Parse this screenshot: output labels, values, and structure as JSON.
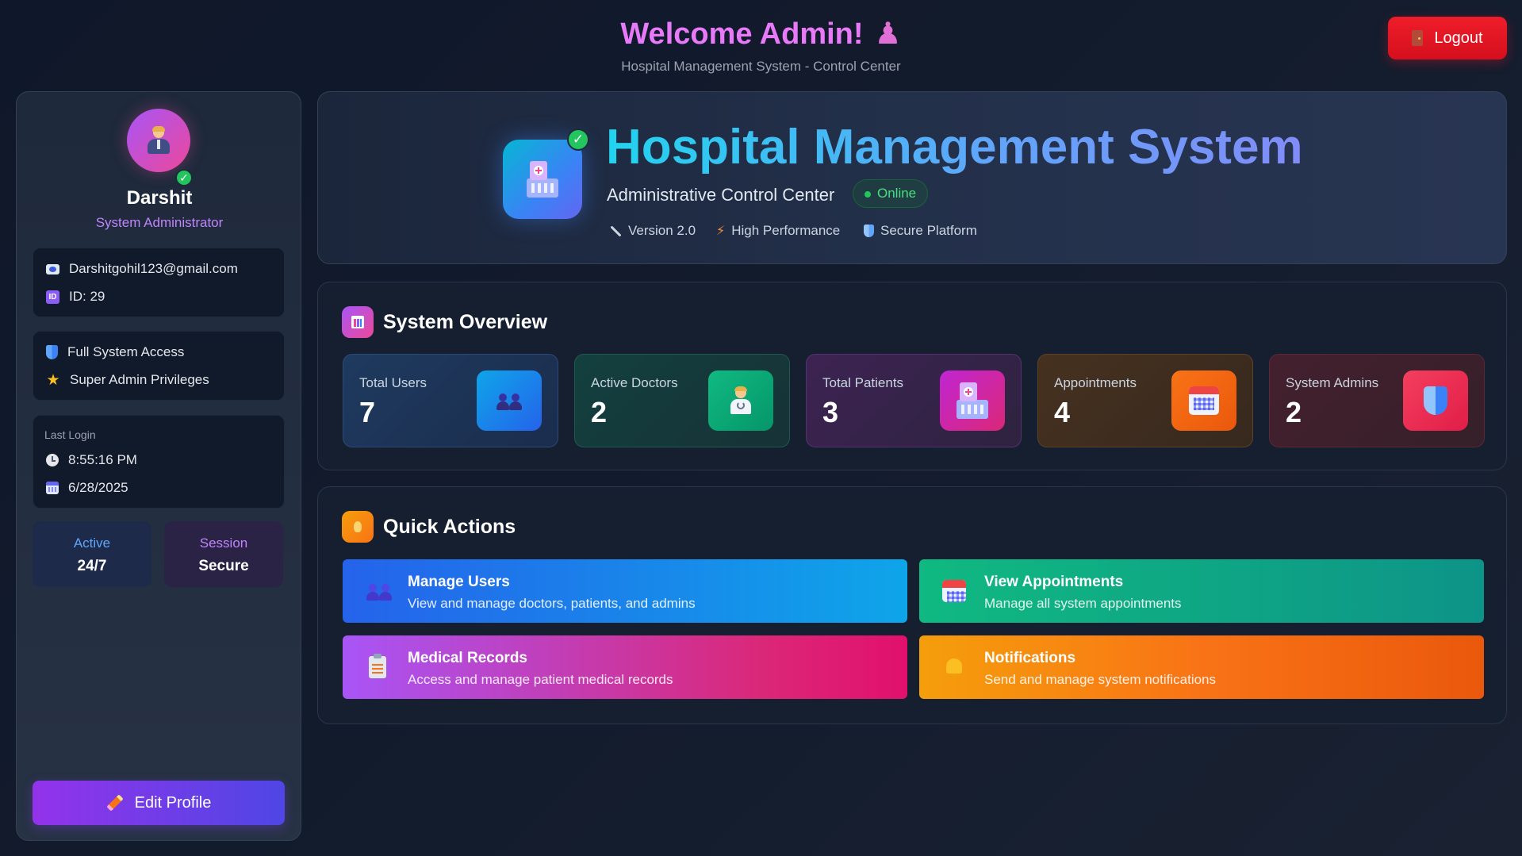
{
  "header": {
    "welcome": "Welcome Admin!",
    "subtitle": "Hospital Management System - Control Center",
    "logout_label": "Logout"
  },
  "profile": {
    "name": "Darshit",
    "role": "System Administrator",
    "email": "Darshitgohil123@gmail.com",
    "id": "ID: 29",
    "permissions": [
      "Full System Access",
      "Super Admin Privileges"
    ],
    "last_login_label": "Last Login",
    "last_login_time": "8:55:16 PM",
    "last_login_date": "6/28/2025",
    "status": {
      "active_label": "Active",
      "active_value": "24/7",
      "session_label": "Session",
      "session_value": "Secure"
    },
    "edit_label": "Edit Profile"
  },
  "hero": {
    "title": "Hospital Management System",
    "subtitle": "Administrative Control Center",
    "status": "Online",
    "meta": [
      "Version 2.0",
      "High Performance",
      "Secure Platform"
    ]
  },
  "overview": {
    "title": "System Overview",
    "stats": [
      {
        "label": "Total Users",
        "value": "7",
        "icon": "users-icon",
        "color": "#3b82f6"
      },
      {
        "label": "Active Doctors",
        "value": "2",
        "icon": "doctor-icon",
        "color": "#10b981"
      },
      {
        "label": "Total Patients",
        "value": "3",
        "icon": "hospital-icon",
        "color": "#d946ef"
      },
      {
        "label": "Appointments",
        "value": "4",
        "icon": "calendar-icon",
        "color": "#f97316"
      },
      {
        "label": "System Admins",
        "value": "2",
        "icon": "shield-icon",
        "color": "#f43f5e"
      }
    ]
  },
  "quick_actions": {
    "title": "Quick Actions",
    "items": [
      {
        "title": "Manage Users",
        "desc": "View and manage doctors, patients, and admins",
        "icon": "users-icon"
      },
      {
        "title": "View Appointments",
        "desc": "Manage all system appointments",
        "icon": "calendar-icon"
      },
      {
        "title": "Medical Records",
        "desc": "Access and manage patient medical records",
        "icon": "clipboard-icon"
      },
      {
        "title": "Notifications",
        "desc": "Send and manage system notifications",
        "icon": "bell-icon"
      }
    ]
  },
  "colors": {
    "accent": "#e879f9",
    "logout": "#ef1d2a",
    "online": "#22c55e",
    "edit": "#7c3aed"
  }
}
